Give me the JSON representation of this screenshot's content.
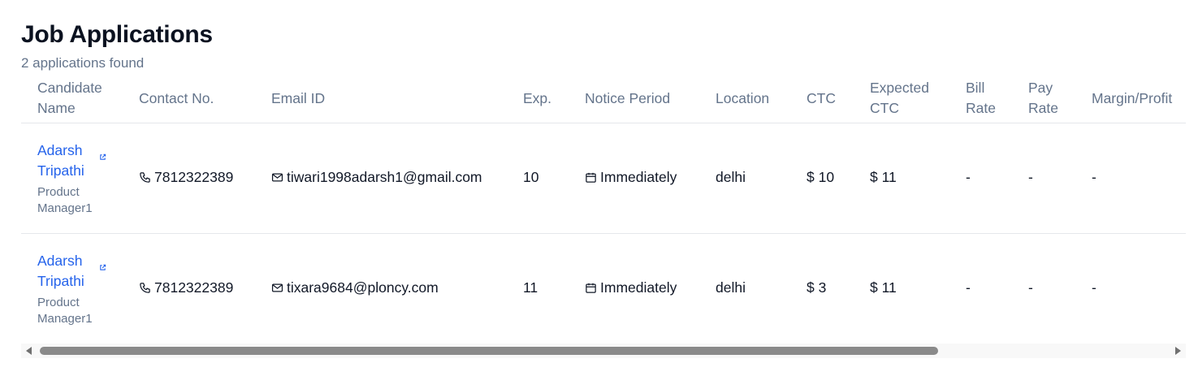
{
  "header": {
    "title": "Job Applications",
    "subtitle": "2 applications found"
  },
  "columns": {
    "candidate_name": "Candidate Name",
    "contact": "Contact No.",
    "email": "Email ID",
    "exp": "Exp.",
    "notice": "Notice Period",
    "location": "Location",
    "ctc": "CTC",
    "expected_ctc": "Expected CTC",
    "bill_rate": "Bill Rate",
    "pay_rate": "Pay Rate",
    "margin": "Margin/Profit"
  },
  "rows": [
    {
      "name": "Adarsh Tripathi",
      "role": "Product Manager1",
      "contact": "7812322389",
      "email": "tiwari1998adarsh1@gmail.com",
      "exp": "10",
      "notice": "Immediately",
      "location": "delhi",
      "ctc": "$ 10",
      "expected_ctc": "$ 11",
      "bill_rate": "-",
      "pay_rate": "-",
      "margin": "-"
    },
    {
      "name": "Adarsh Tripathi",
      "role": "Product Manager1",
      "contact": "7812322389",
      "email": "tixara9684@ploncy.com",
      "exp": "11",
      "notice": "Immediately",
      "location": "delhi",
      "ctc": "$ 3",
      "expected_ctc": "$ 11",
      "bill_rate": "-",
      "pay_rate": "-",
      "margin": "-"
    }
  ],
  "scroll": {
    "horizontal_position_fraction": 0
  },
  "colors": {
    "link": "#2563eb",
    "muted": "#64748b",
    "border": "#e5e7eb"
  }
}
